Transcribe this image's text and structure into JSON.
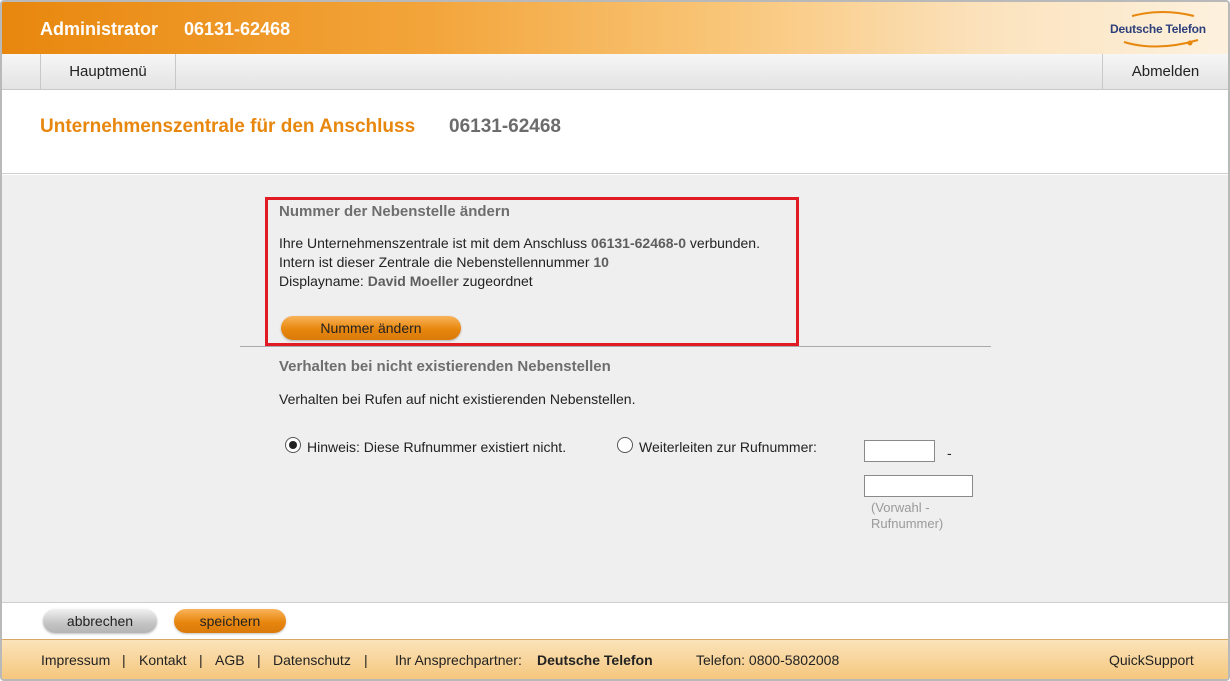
{
  "header": {
    "title": "Administrator",
    "number": "06131-62468",
    "brand": "Deutsche Telefon"
  },
  "menu": {
    "home": "Hauptmenü",
    "logout": "Abmelden"
  },
  "page": {
    "title": "Unternehmenszentrale für den Anschluss",
    "number": "06131-62468"
  },
  "extension": {
    "title": "Nummer der Nebenstelle ändern",
    "line1_pre": "Ihre Unternehmenszentrale ist mit dem Anschluss",
    "line1_value": "06131-62468-0",
    "line1_post": "verbunden.",
    "line2_pre": "Intern ist dieser Zentrale die Nebenstellennummer",
    "line2_value": "10",
    "line3_pre": "Displayname:",
    "line3_value": "David Moeller",
    "line3_post": "zugeordnet",
    "button": "Nummer ändern"
  },
  "behavior": {
    "title": "Verhalten bei nicht existierenden Nebenstellen",
    "description": "Verhalten bei Rufen auf nicht existierenden Nebenstellen.",
    "option_notice": "Hinweis: Diese Rufnummer existiert nicht.",
    "option_notice_checked": true,
    "option_forward": "Weiterleiten zur Rufnummer:",
    "option_forward_checked": false,
    "area_code_value": "",
    "dash": "-",
    "number_value": "",
    "hint_line1": "(Vorwahl -",
    "hint_line2": "Rufnummer)"
  },
  "actions": {
    "cancel": "abbrechen",
    "save": "speichern"
  },
  "footer": {
    "impressum": "Impressum",
    "kontakt": "Kontakt",
    "agb": "AGB",
    "datenschutz": "Datenschutz",
    "separator": "|",
    "partner_label": "Ihr Ansprechpartner:",
    "partner_name": "Deutsche Telefon",
    "phone": "Telefon: 0800-5802008",
    "quicksupport": "QuickSupport"
  },
  "colors": {
    "accent": "#e8870e",
    "highlight_border": "#e01b24",
    "background": "#efefef"
  }
}
